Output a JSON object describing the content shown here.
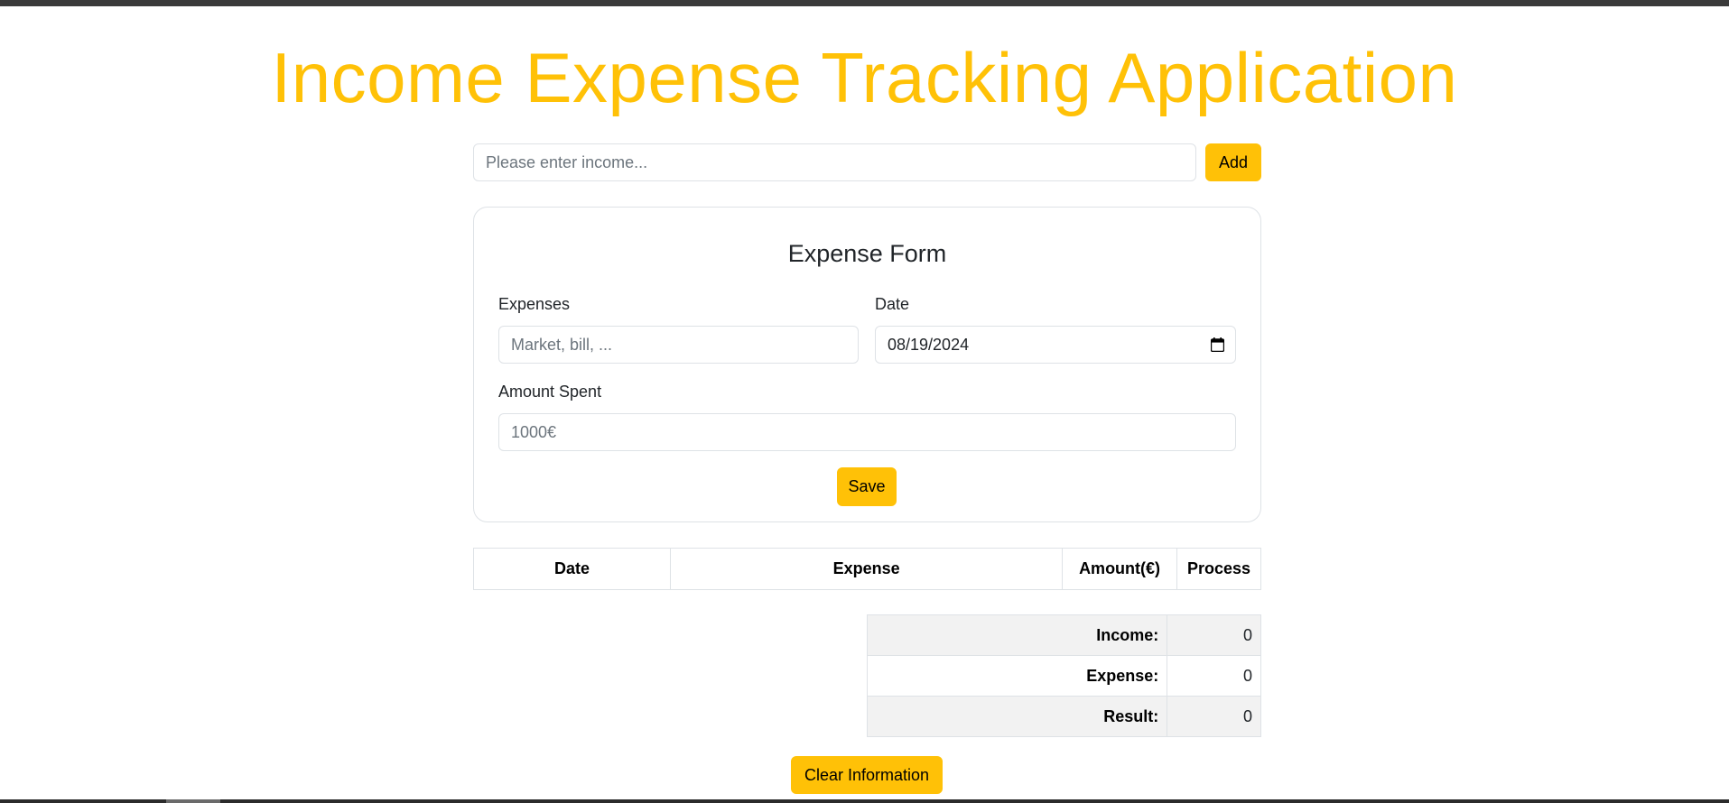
{
  "app": {
    "title": "Income Expense Tracking Application",
    "accent_color": "#ffc107"
  },
  "income": {
    "input_value": "",
    "input_placeholder": "Please enter income...",
    "add_label": "Add"
  },
  "expense_form": {
    "title": "Expense Form",
    "expenses_label": "Expenses",
    "expenses_placeholder": "Market, bill, ...",
    "expenses_value": "",
    "date_label": "Date",
    "date_value": "08/19/2024",
    "amount_label": "Amount Spent",
    "amount_placeholder": "1000€",
    "amount_value": "",
    "save_label": "Save"
  },
  "expense_table": {
    "headers": [
      "Date",
      "Expense",
      "Amount(€)",
      "Process"
    ],
    "rows": []
  },
  "summary": {
    "income_label": "Income:",
    "income_value": "0",
    "expense_label": "Expense:",
    "expense_value": "0",
    "result_label": "Result:",
    "result_value": "0"
  },
  "actions": {
    "clear_label": "Clear Information"
  },
  "icons": {
    "date_picker": "calendar-icon"
  }
}
